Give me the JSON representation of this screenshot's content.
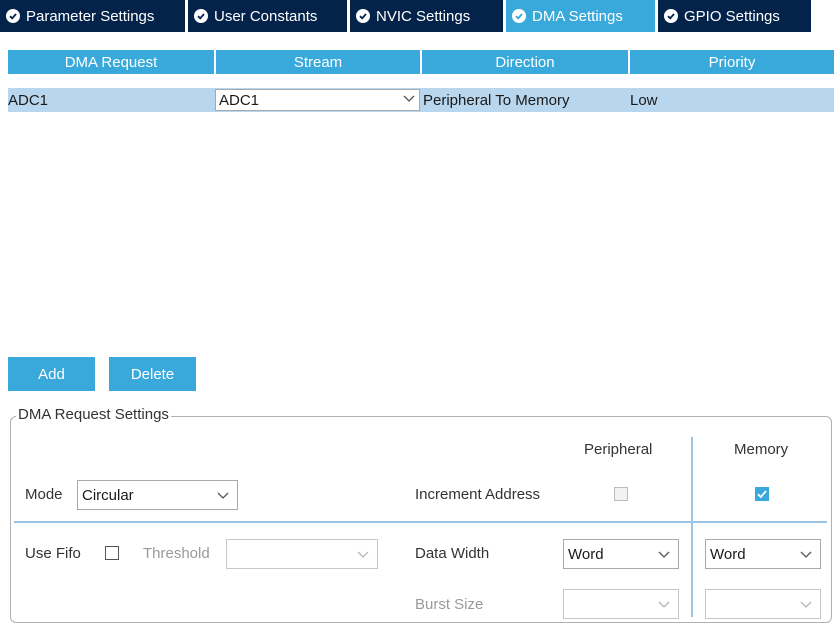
{
  "tabs": [
    {
      "label": "Parameter Settings",
      "active": false
    },
    {
      "label": "User Constants",
      "active": false
    },
    {
      "label": "NVIC Settings",
      "active": false
    },
    {
      "label": "DMA Settings",
      "active": true
    },
    {
      "label": "GPIO Settings",
      "active": false
    }
  ],
  "table": {
    "headers": [
      "DMA Request",
      "Stream",
      "Direction",
      "Priority"
    ],
    "rows": [
      {
        "dma_request": "ADC1",
        "stream": "ADC1",
        "direction": "Peripheral To Memory",
        "priority": "Low"
      }
    ]
  },
  "buttons": {
    "add": "Add",
    "delete": "Delete"
  },
  "settings": {
    "title": "DMA Request Settings",
    "peripheral_header": "Peripheral",
    "memory_header": "Memory",
    "mode_label": "Mode",
    "mode_value": "Circular",
    "increment_label": "Increment Address",
    "increment_peripheral_checked": false,
    "increment_memory_checked": true,
    "use_fifo_label": "Use Fifo",
    "use_fifo_checked": false,
    "threshold_label": "Threshold",
    "threshold_value": "",
    "data_width_label": "Data Width",
    "data_width_peripheral": "Word",
    "data_width_memory": "Word",
    "burst_size_label": "Burst Size",
    "burst_peripheral": "",
    "burst_memory": ""
  },
  "colors": {
    "tab_bg": "#03234b",
    "accent": "#39a9dc",
    "row_selected": "#b8d6ee"
  }
}
